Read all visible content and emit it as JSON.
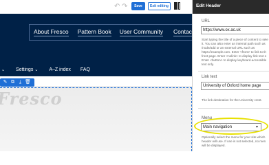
{
  "toolbar": {
    "undo_icon": "↶",
    "redo_icon": "↷",
    "save_label": "Save",
    "exit_label": "Exit editing",
    "panel_toggle_icon": "panel-toggle-icon",
    "accent": "#1f6fd6"
  },
  "site": {
    "hero_bg": "#002147",
    "top_links": [
      "About Fresco",
      "Pattern Book",
      "User Community",
      "Contact us"
    ],
    "main_nav": [
      {
        "label": "",
        "has_chevron": true
      },
      {
        "label": "Settings",
        "has_chevron": true
      },
      {
        "label": "A–Z index",
        "has_chevron": false
      },
      {
        "label": "FAQ",
        "has_chevron": false
      }
    ],
    "chevron_glyph": "⌄",
    "block_toolbar_icons": [
      "edit-icon",
      "copy-icon",
      "download-icon",
      "delete-icon"
    ],
    "block_toolbar_glyphs": [
      "✎",
      "⧉",
      "⤓",
      "🗑"
    ],
    "logo_text": "Fresco"
  },
  "panel": {
    "title": "Edit Header",
    "header_bg": "#2a2a2a",
    "url_label": "URL",
    "url_value": "https://www.ox.ac.uk",
    "url_help": [
      "Start typing the title of a piece of content to sele",
      "it. You can also enter an internal path such as",
      "/node/add or an external URL such as",
      "https://example.com. Enter <front> to link to th",
      "front page. Enter <nolink> to display link text o",
      "Enter <button> to display keyboard-accessible",
      "text only."
    ],
    "link_text_label": "Link text",
    "link_text_value": "University of Oxford home page",
    "link_text_help": "The link destination for the University crest.",
    "menu_label": "Menu",
    "menu_value": "Main navigation",
    "menu_help": [
      "Optionally select the menu for your site which",
      "header will use. If one is not selected, no men",
      "will be displayed."
    ],
    "highlight_color": "#e8e000"
  }
}
